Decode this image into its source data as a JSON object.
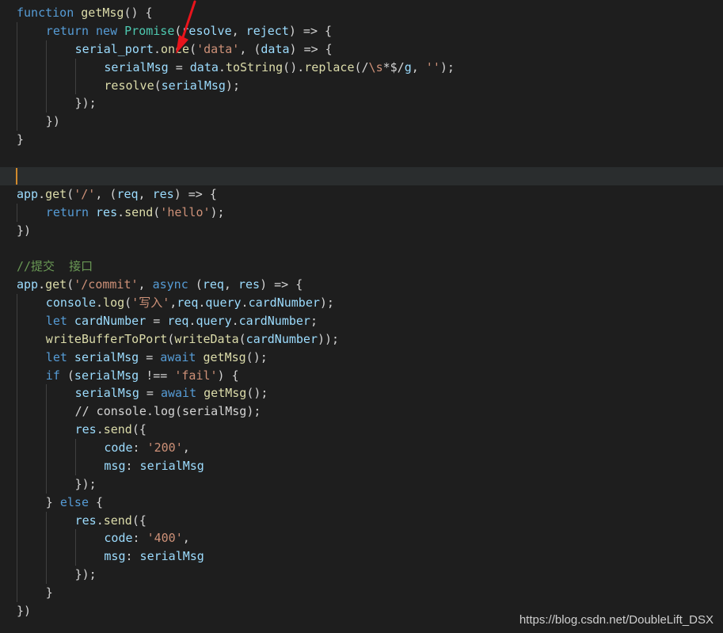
{
  "code": {
    "lines": [
      {
        "indent": 0,
        "tokens": [
          [
            "function ",
            "kw"
          ],
          [
            "getMsg",
            "fn"
          ],
          [
            "() {",
            "op"
          ]
        ]
      },
      {
        "indent": 1,
        "tokens": [
          [
            "return ",
            "kw"
          ],
          [
            "new ",
            "kw"
          ],
          [
            "Promise",
            "cls"
          ],
          [
            "(",
            "op"
          ],
          [
            "resolve",
            "var"
          ],
          [
            ", ",
            "op"
          ],
          [
            "reject",
            "var"
          ],
          [
            ") => {",
            "op"
          ]
        ]
      },
      {
        "indent": 2,
        "tokens": [
          [
            "serial_port",
            "var"
          ],
          [
            ".",
            "op"
          ],
          [
            "once",
            "fn"
          ],
          [
            "(",
            "op"
          ],
          [
            "'data'",
            "str"
          ],
          [
            ", (",
            "op"
          ],
          [
            "data",
            "var"
          ],
          [
            ") => {",
            "op"
          ]
        ]
      },
      {
        "indent": 3,
        "tokens": [
          [
            "serialMsg",
            "var"
          ],
          [
            " = ",
            "op"
          ],
          [
            "data",
            "var"
          ],
          [
            ".",
            "op"
          ],
          [
            "toString",
            "fn"
          ],
          [
            "().",
            "op"
          ],
          [
            "replace",
            "fn"
          ],
          [
            "(/",
            "op"
          ],
          [
            "\\s",
            "str"
          ],
          [
            "*$/",
            "op"
          ],
          [
            "g",
            "var"
          ],
          [
            ", ",
            "op"
          ],
          [
            "''",
            "str"
          ],
          [
            ");",
            "op"
          ]
        ]
      },
      {
        "indent": 3,
        "tokens": [
          [
            "resolve",
            "fn"
          ],
          [
            "(",
            "op"
          ],
          [
            "serialMsg",
            "var"
          ],
          [
            ");",
            "op"
          ]
        ]
      },
      {
        "indent": 2,
        "tokens": [
          [
            "});",
            "op"
          ]
        ]
      },
      {
        "indent": 1,
        "tokens": [
          [
            "})",
            "op"
          ]
        ]
      },
      {
        "indent": 0,
        "tokens": [
          [
            "}",
            "op"
          ]
        ]
      },
      {
        "indent": 0,
        "tokens": []
      },
      {
        "indent": 0,
        "current": true,
        "tokens": []
      },
      {
        "indent": 0,
        "tokens": [
          [
            "app",
            "var"
          ],
          [
            ".",
            "op"
          ],
          [
            "get",
            "fn"
          ],
          [
            "(",
            "op"
          ],
          [
            "'/'",
            "str"
          ],
          [
            ", (",
            "op"
          ],
          [
            "req",
            "var"
          ],
          [
            ", ",
            "op"
          ],
          [
            "res",
            "var"
          ],
          [
            ") => {",
            "op"
          ]
        ]
      },
      {
        "indent": 1,
        "tokens": [
          [
            "return ",
            "kw"
          ],
          [
            "res",
            "var"
          ],
          [
            ".",
            "op"
          ],
          [
            "send",
            "fn"
          ],
          [
            "(",
            "op"
          ],
          [
            "'hello'",
            "str"
          ],
          [
            ");",
            "op"
          ]
        ]
      },
      {
        "indent": 0,
        "tokens": [
          [
            "})",
            "op"
          ]
        ]
      },
      {
        "indent": 0,
        "tokens": []
      },
      {
        "indent": 0,
        "tokens": [
          [
            "//提交  接口",
            "cmt"
          ]
        ]
      },
      {
        "indent": 0,
        "tokens": [
          [
            "app",
            "var"
          ],
          [
            ".",
            "op"
          ],
          [
            "get",
            "fn"
          ],
          [
            "(",
            "op"
          ],
          [
            "'/commit'",
            "str"
          ],
          [
            ", ",
            "op"
          ],
          [
            "async ",
            "kw"
          ],
          [
            "(",
            "op"
          ],
          [
            "req",
            "var"
          ],
          [
            ", ",
            "op"
          ],
          [
            "res",
            "var"
          ],
          [
            ") => {",
            "op"
          ]
        ]
      },
      {
        "indent": 1,
        "tokens": [
          [
            "console",
            "var"
          ],
          [
            ".",
            "op"
          ],
          [
            "log",
            "fn"
          ],
          [
            "(",
            "op"
          ],
          [
            "'写入'",
            "str"
          ],
          [
            ",",
            "op"
          ],
          [
            "req",
            "var"
          ],
          [
            ".",
            "op"
          ],
          [
            "query",
            "var"
          ],
          [
            ".",
            "op"
          ],
          [
            "cardNumber",
            "var"
          ],
          [
            ");",
            "op"
          ]
        ]
      },
      {
        "indent": 1,
        "tokens": [
          [
            "let ",
            "kw"
          ],
          [
            "cardNumber",
            "var"
          ],
          [
            " = ",
            "op"
          ],
          [
            "req",
            "var"
          ],
          [
            ".",
            "op"
          ],
          [
            "query",
            "var"
          ],
          [
            ".",
            "op"
          ],
          [
            "cardNumber",
            "var"
          ],
          [
            ";",
            "op"
          ]
        ]
      },
      {
        "indent": 1,
        "tokens": [
          [
            "writeBufferToPort",
            "fn"
          ],
          [
            "(",
            "op"
          ],
          [
            "writeData",
            "fn"
          ],
          [
            "(",
            "op"
          ],
          [
            "cardNumber",
            "var"
          ],
          [
            "));",
            "op"
          ]
        ]
      },
      {
        "indent": 1,
        "tokens": [
          [
            "let ",
            "kw"
          ],
          [
            "serialMsg",
            "var"
          ],
          [
            " = ",
            "op"
          ],
          [
            "await ",
            "kw"
          ],
          [
            "getMsg",
            "fn"
          ],
          [
            "();",
            "op"
          ]
        ]
      },
      {
        "indent": 1,
        "tokens": [
          [
            "if ",
            "kw"
          ],
          [
            "(",
            "op"
          ],
          [
            "serialMsg",
            "var"
          ],
          [
            " !== ",
            "op"
          ],
          [
            "'fail'",
            "str"
          ],
          [
            ") {",
            "op"
          ]
        ]
      },
      {
        "indent": 2,
        "tokens": [
          [
            "serialMsg",
            "var"
          ],
          [
            " = ",
            "op"
          ],
          [
            "await ",
            "kw"
          ],
          [
            "getMsg",
            "fn"
          ],
          [
            "();",
            "op"
          ]
        ]
      },
      {
        "indent": 2,
        "tokens": [
          [
            "// console.log(serialMsg);",
            "op"
          ]
        ]
      },
      {
        "indent": 2,
        "tokens": [
          [
            "res",
            "var"
          ],
          [
            ".",
            "op"
          ],
          [
            "send",
            "fn"
          ],
          [
            "({",
            "op"
          ]
        ]
      },
      {
        "indent": 3,
        "tokens": [
          [
            "code",
            "var"
          ],
          [
            ": ",
            "op"
          ],
          [
            "'200'",
            "str"
          ],
          [
            ",",
            "op"
          ]
        ]
      },
      {
        "indent": 3,
        "tokens": [
          [
            "msg",
            "var"
          ],
          [
            ": ",
            "op"
          ],
          [
            "serialMsg",
            "var"
          ]
        ]
      },
      {
        "indent": 2,
        "tokens": [
          [
            "});",
            "op"
          ]
        ]
      },
      {
        "indent": 1,
        "tokens": [
          [
            "} ",
            "op"
          ],
          [
            "else ",
            "kw"
          ],
          [
            "{",
            "op"
          ]
        ]
      },
      {
        "indent": 2,
        "tokens": [
          [
            "res",
            "var"
          ],
          [
            ".",
            "op"
          ],
          [
            "send",
            "fn"
          ],
          [
            "({",
            "op"
          ]
        ]
      },
      {
        "indent": 3,
        "tokens": [
          [
            "code",
            "var"
          ],
          [
            ": ",
            "op"
          ],
          [
            "'400'",
            "str"
          ],
          [
            ",",
            "op"
          ]
        ]
      },
      {
        "indent": 3,
        "tokens": [
          [
            "msg",
            "var"
          ],
          [
            ": ",
            "op"
          ],
          [
            "serialMsg",
            "var"
          ]
        ]
      },
      {
        "indent": 2,
        "tokens": [
          [
            "});",
            "op"
          ]
        ]
      },
      {
        "indent": 1,
        "tokens": [
          [
            "}",
            "op"
          ]
        ]
      },
      {
        "indent": 0,
        "tokens": [
          [
            "})",
            "op"
          ]
        ]
      }
    ]
  },
  "colors": {
    "background": "#1e1e1e",
    "keyword": "#569cd6",
    "function": "#dcdcaa",
    "string": "#ce9178",
    "variable": "#9cdcfe",
    "comment": "#6a9955",
    "cursor_line_marker": "#d18a2c",
    "annotation_arrow": "#e8141c"
  },
  "annotation": {
    "icon": "red-arrow-icon"
  },
  "watermark": "https://blog.csdn.net/DoubleLift_DSX"
}
